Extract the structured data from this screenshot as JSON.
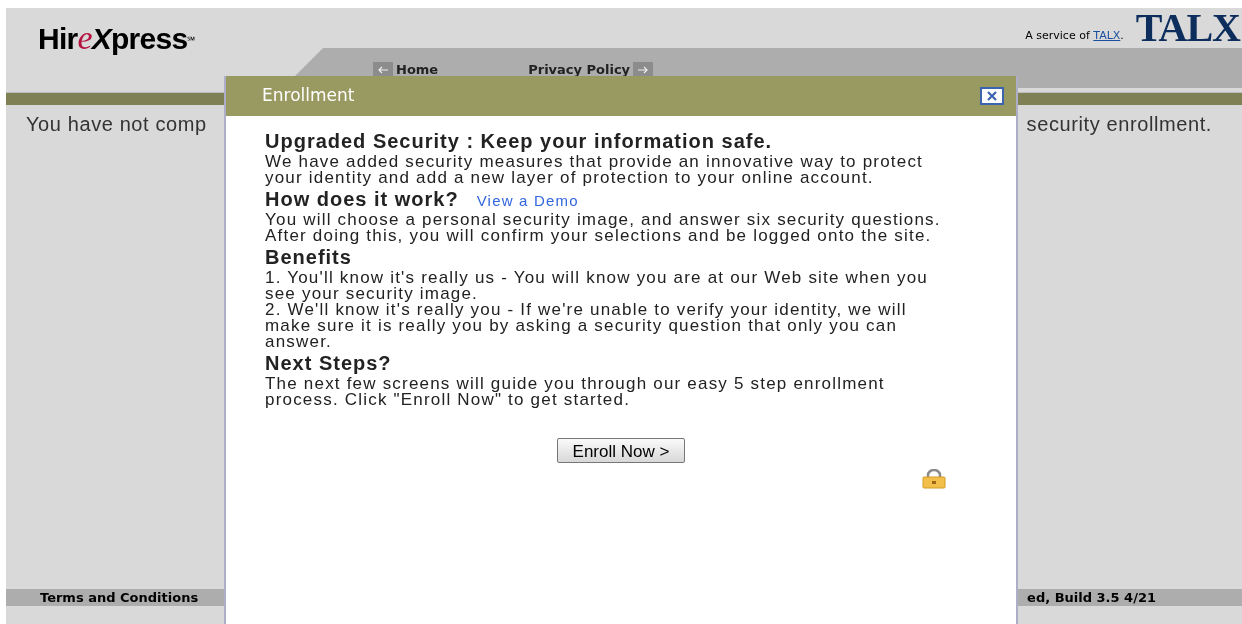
{
  "header": {
    "logo": [
      {
        "text": "Hir",
        "kind": "plain"
      },
      {
        "text": "e",
        "kind": "accent"
      },
      {
        "text": "X",
        "kind": "bold"
      },
      {
        "text": "press",
        "kind": "plain"
      }
    ],
    "logo_mark": "℠",
    "service_text": "A service of ",
    "service_link": "TALX",
    "service_end": ".",
    "brand": "TALX"
  },
  "nav": [
    {
      "label": "Home",
      "kind": "back"
    },
    {
      "label": "Privacy Policy",
      "kind": "forward"
    }
  ],
  "notice": {
    "left": "You have not comp",
    "right": "security enrollment."
  },
  "footer": {
    "left": "Terms and Conditions",
    "right": "ed, Build 3.5 4/21"
  },
  "dialog": {
    "title": "Enrollment",
    "sections": [
      {
        "heading": "Upgraded Security : Keep your information safe.",
        "paragraphs": [
          "We have added security measures that provide an innovative way to protect your identity and add a new layer of protection to your online account."
        ]
      },
      {
        "heading": "How does it work?",
        "link": "View a Demo",
        "paragraphs": [
          "You will choose a personal security image, and answer six security questions. After doing this, you will confirm your selections and be logged onto the site."
        ]
      },
      {
        "heading": "Benefits",
        "paragraphs": [
          "1. You'll know it's really us - You will know you are at our Web site when you see your security image.",
          "2. We'll know it's really you - If we're unable to verify your identity, we will make sure it is really you by asking a security question that only you can answer."
        ]
      },
      {
        "heading": "Next Steps?",
        "paragraphs": [
          "The next few screens will guide you through our easy 5 step enrollment process. Click \"Enroll Now\" to get started."
        ]
      }
    ],
    "button": "Enroll Now >"
  }
}
